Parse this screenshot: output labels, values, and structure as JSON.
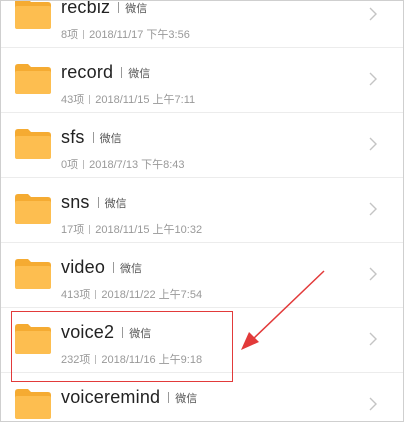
{
  "folders": [
    {
      "name": "recbiz",
      "source": "微信",
      "count": "8项",
      "time": "2018/11/17 下午3:56"
    },
    {
      "name": "record",
      "source": "微信",
      "count": "43项",
      "time": "2018/11/15 上午7:11"
    },
    {
      "name": "sfs",
      "source": "微信",
      "count": "0项",
      "time": "2018/7/13 下午8:43"
    },
    {
      "name": "sns",
      "source": "微信",
      "count": "17项",
      "time": "2018/11/15 上午10:32"
    },
    {
      "name": "video",
      "source": "微信",
      "count": "413项",
      "time": "2018/11/22 上午7:54"
    },
    {
      "name": "voice2",
      "source": "微信",
      "count": "232项",
      "time": "2018/11/16 上午9:18"
    },
    {
      "name": "voiceremind",
      "source": "微信",
      "count": "",
      "time": ""
    }
  ],
  "colors": {
    "folder": "#fdbe50",
    "folder_dark": "#f5ab32",
    "highlight": "#e23a3a",
    "arrow": "#e23a3a"
  },
  "icons": {
    "folder": "folder-icon",
    "chevron": "chevron-right-icon"
  }
}
